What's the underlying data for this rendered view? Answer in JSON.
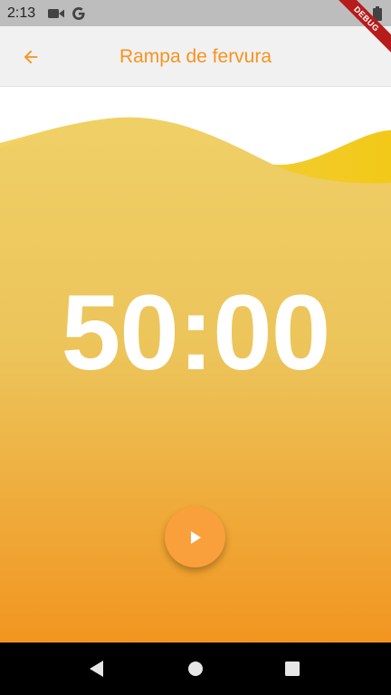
{
  "status_bar": {
    "time": "2:13",
    "icons": [
      "video-camera-icon",
      "google-g-icon",
      "wifi-icon",
      "battery-icon"
    ]
  },
  "debug_banner": {
    "label": "DEBUG",
    "color": "#b71c1c"
  },
  "app_bar": {
    "title": "Rampa de fervura",
    "back_icon": "arrow-back-icon",
    "accent_color": "#f7931e",
    "background": "#f1f1f1"
  },
  "timer": {
    "display": "50:00",
    "gradient_top": "#ecc963",
    "gradient_bottom": "#f29520"
  },
  "controls": {
    "play_icon": "play-icon",
    "button_color": "#f9a03c"
  },
  "navigation": {
    "back_icon": "nav-back-icon",
    "home_icon": "nav-home-icon",
    "recents_icon": "nav-recents-icon"
  }
}
